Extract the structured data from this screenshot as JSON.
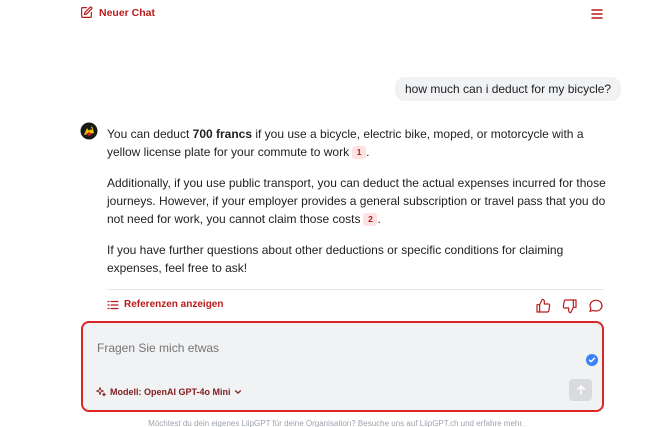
{
  "header": {
    "new_chat_label": "Neuer Chat"
  },
  "conversation": {
    "user_message": "how much can i deduct for my bicycle?",
    "answer": {
      "p1_before": "You can deduct ",
      "p1_bold": "700 francs",
      "p1_after": " if you use a bicycle, electric bike, moped, or motorcycle with a yellow license plate for your commute to work",
      "p1_cite": "1",
      "p1_end": ".",
      "p2": "Additionally, if you use public transport, you can deduct the actual expenses incurred for those journeys. However, if your employer provides a general subscription or travel pass that you do not need for work, you cannot claim those costs",
      "p2_cite": "2",
      "p2_end": ".",
      "p3": "If you have further questions about other deductions or specific conditions for claiming expenses, feel free to ask!"
    },
    "references_label": "Referenzen anzeigen"
  },
  "composer": {
    "placeholder": "Fragen Sie mich etwas",
    "model_label": "Modell: OpenAI GPT-4o Mini"
  },
  "footer": {
    "text": "Möchtest du dein eigenes LiipGPT für deine Organisation? Besuche uns auf LiipGPT.ch und erfahre mehr."
  },
  "colors": {
    "accent": "#b91c1c",
    "border": "#dc2626",
    "check": "#3b82f6",
    "bubble": "#f1f2f4"
  }
}
